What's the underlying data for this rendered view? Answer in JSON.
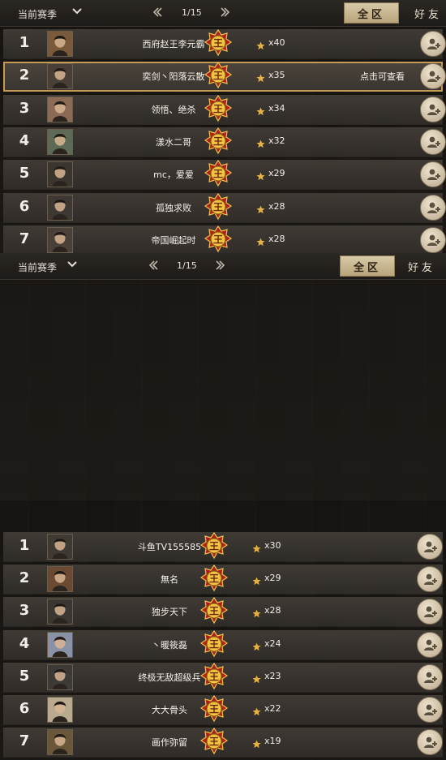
{
  "panels": [
    {
      "season_label": "当前赛季",
      "page": "1/15",
      "tab_all": "全区",
      "tab_friends": "好友",
      "hint": "点击可查看",
      "rows": [
        {
          "rank": "1",
          "name": "西府赵王李元霸",
          "count": "x40",
          "avatar_color": "#7a5a3a"
        },
        {
          "rank": "2",
          "name": "奕剑丶阳落云散",
          "count": "x35",
          "avatar_color": "#4a3f36"
        },
        {
          "rank": "3",
          "name": "领悟、绝杀",
          "count": "x34",
          "avatar_color": "#8b6b55"
        },
        {
          "rank": "4",
          "name": "漾水二哥",
          "count": "x32",
          "avatar_color": "#5d6a55"
        },
        {
          "rank": "5",
          "name": "mc，爱爱",
          "count": "x29",
          "avatar_color": "#3b3530"
        },
        {
          "rank": "6",
          "name": "孤独求败",
          "count": "x28",
          "avatar_color": "#3d3833"
        },
        {
          "rank": "7",
          "name": "帝国崛起时",
          "count": "x28",
          "avatar_color": "#4a403a"
        }
      ]
    },
    {
      "season_label": "当前赛季",
      "page": "1/15",
      "tab_all": "全区",
      "tab_friends": "好友",
      "rows": [
        {
          "rank": "1",
          "name": "斗鱼TV155585",
          "count": "x30",
          "avatar_color": "#3e3a33"
        },
        {
          "rank": "2",
          "name": "無名",
          "count": "x29",
          "avatar_color": "#6b4a34"
        },
        {
          "rank": "3",
          "name": "独步天下",
          "count": "x28",
          "avatar_color": "#3a3733"
        },
        {
          "rank": "4",
          "name": "丶暖筱磊",
          "count": "x24",
          "avatar_color": "#8a93a5"
        },
        {
          "rank": "5",
          "name": "终极无敌超级兵",
          "count": "x23",
          "avatar_color": "#3c3a36"
        },
        {
          "rank": "6",
          "name": "大大骨头",
          "count": "x22",
          "avatar_color": "#b9a98f"
        },
        {
          "rank": "7",
          "name": "画作弥留",
          "count": "x19",
          "avatar_color": "#6a5638"
        }
      ]
    }
  ],
  "colors": {
    "gold": "#d9a23a",
    "highlight": "#c49a55"
  }
}
